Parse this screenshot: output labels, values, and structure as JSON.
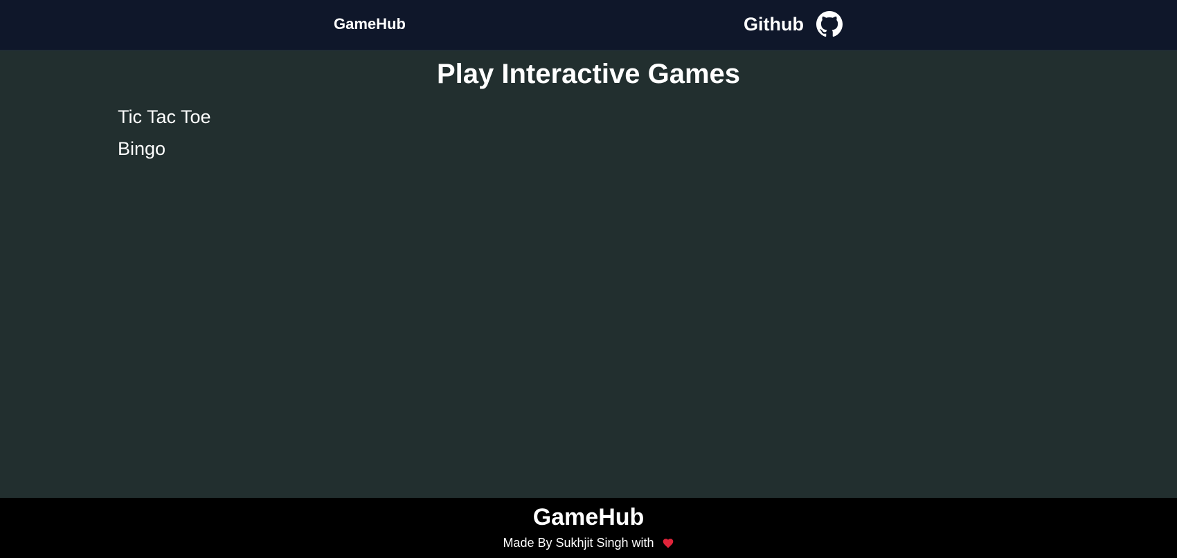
{
  "navbar": {
    "brand": "GameHub",
    "github_label": "Github",
    "github_icon": "github-icon"
  },
  "main": {
    "title": "Play Interactive Games",
    "games": [
      "Tic Tac Toe",
      "Bingo"
    ]
  },
  "footer": {
    "title": "GameHub",
    "credit": "Made By Sukhjit Singh with",
    "credit_icon": "heart-icon"
  },
  "colors": {
    "navbar_bg": "#0f172a",
    "main_bg": "#222f2f",
    "footer_bg": "#000000",
    "heart": "#e0243a",
    "text": "#ffffff"
  }
}
